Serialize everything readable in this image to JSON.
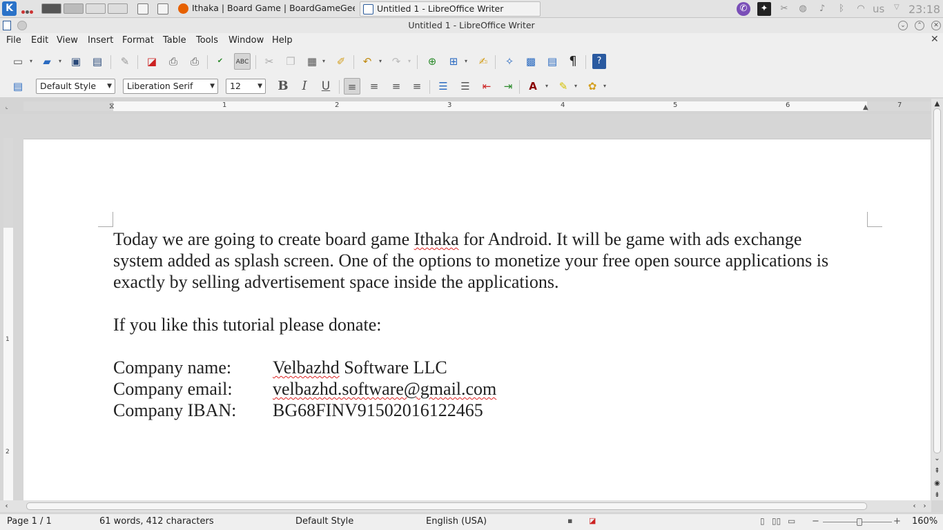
{
  "taskbar": {
    "tasks": [
      {
        "label": "Ithaka | Board Game | BoardGameGeek - "
      },
      {
        "label": "Untitled 1 - LibreOffice Writer"
      }
    ],
    "keyboard_layout": "us",
    "clock": "23:18"
  },
  "window": {
    "title": "Untitled 1 - LibreOffice Writer"
  },
  "menu": [
    "File",
    "Edit",
    "View",
    "Insert",
    "Format",
    "Table",
    "Tools",
    "Window",
    "Help"
  ],
  "formatting": {
    "paragraph_style": "Default Style",
    "font_name": "Liberation Serif",
    "font_size": "12"
  },
  "ruler": {
    "marks": [
      "1",
      "2",
      "3",
      "4",
      "5",
      "6",
      "7"
    ],
    "vmarks": [
      "1",
      "2"
    ]
  },
  "document": {
    "para1_before": "Today we are going to create board game ",
    "para1_misspelled": "Ithaka",
    "para1_line1_after": " for Android. It will be game with ads exchange",
    "para1_line2": "system added as splash screen. One of the options to monetize your free open source applications is",
    "para1_line3": "exactly by selling advertisement space inside the applications.",
    "para2": "If you like this tutorial please donate:",
    "company_name_label": "Company name:",
    "company_name_misspelled": "Velbazhd",
    "company_name_rest": " Software LLC",
    "company_email_label": "Company email:",
    "company_email": "velbazhd.software@gmail.com",
    "company_iban_label": "Company IBAN:",
    "company_iban": "BG68FINV91502016122465"
  },
  "status": {
    "page": "Page 1 / 1",
    "counts": "61 words, 412 characters",
    "page_style": "Default Style",
    "language": "English (USA)",
    "zoom": "160%"
  }
}
